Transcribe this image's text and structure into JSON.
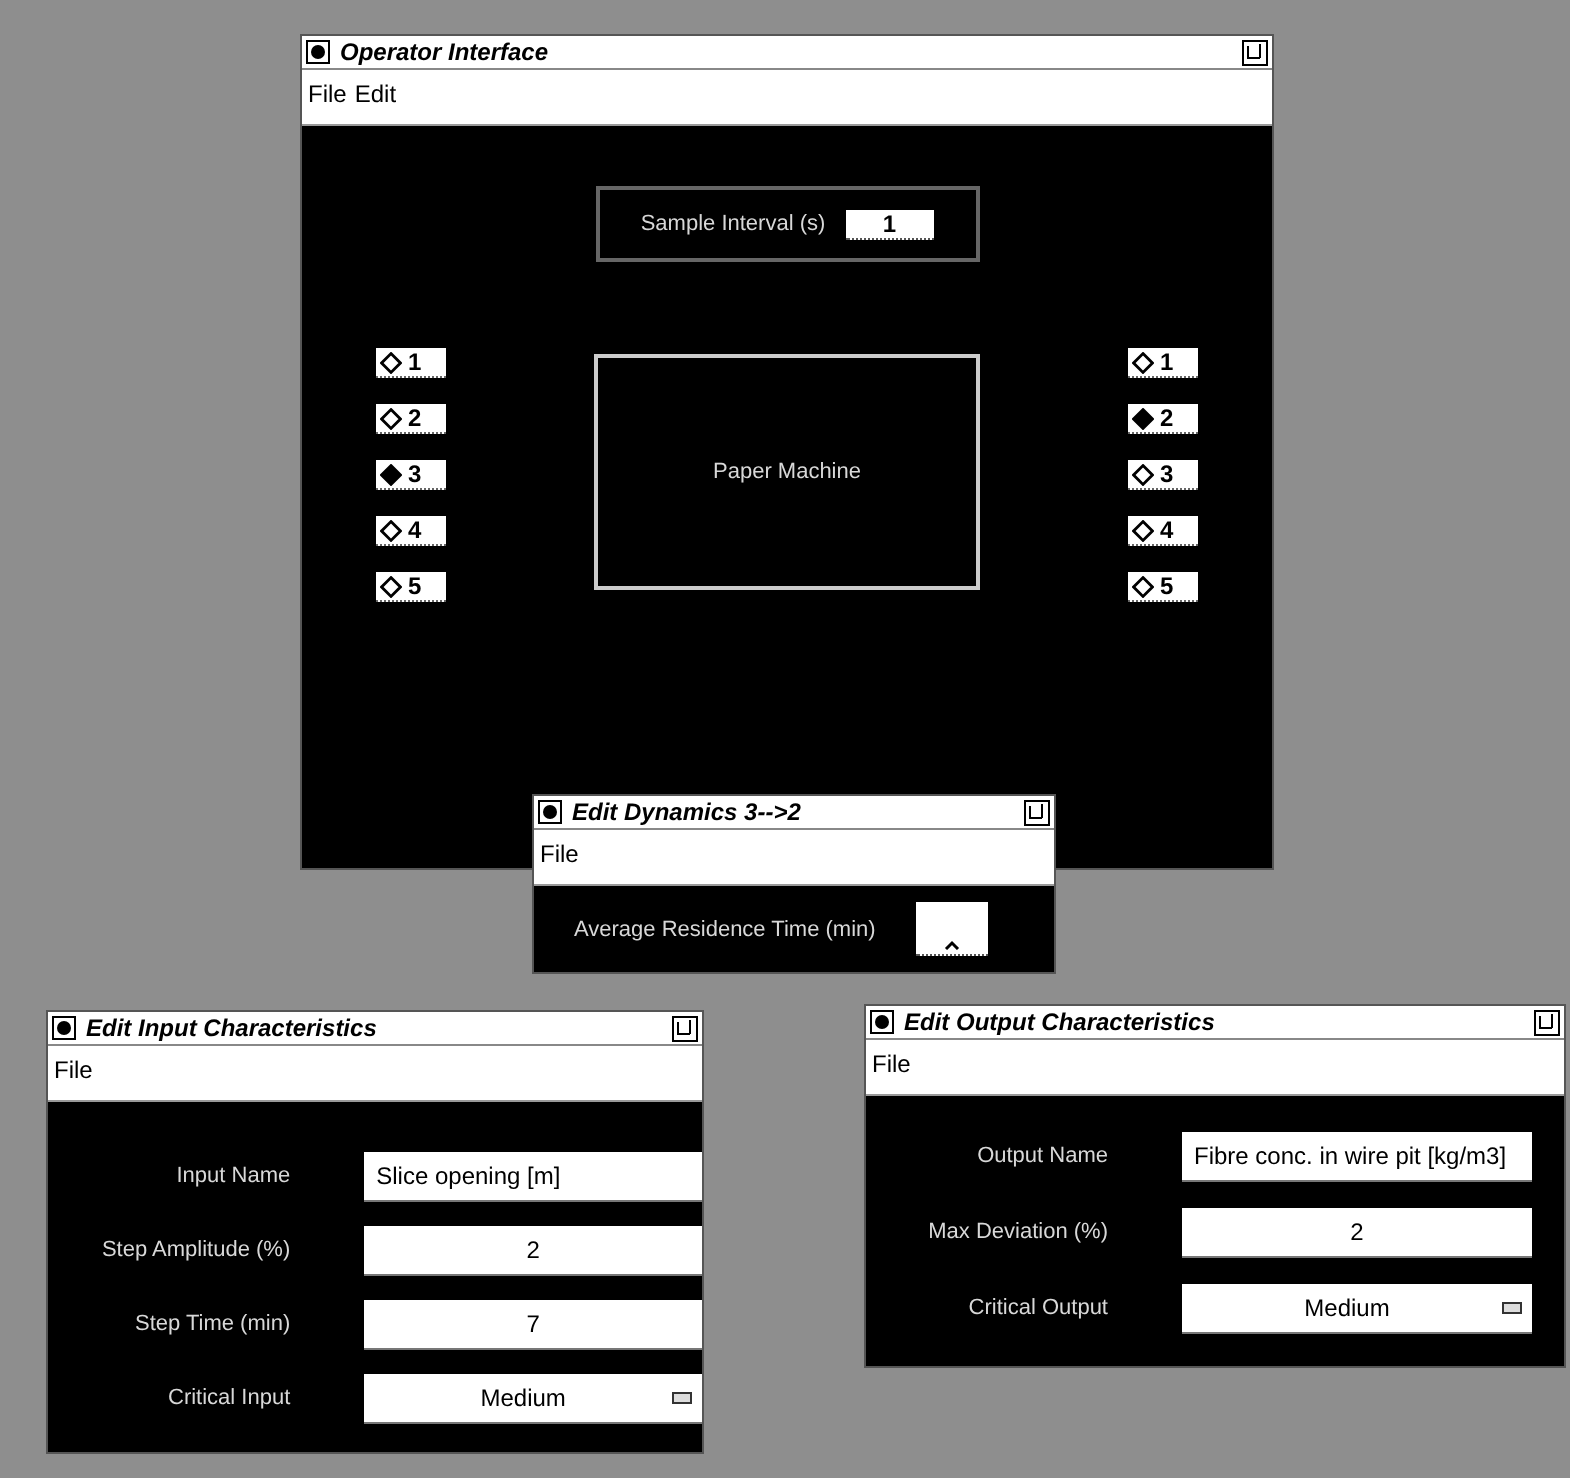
{
  "operator_window": {
    "title": "Operator Interface",
    "menu": [
      "File",
      "Edit"
    ],
    "sample_interval": {
      "label": "Sample Interval (s)",
      "value": "1"
    },
    "inputs": [
      {
        "label": "1",
        "selected": false
      },
      {
        "label": "2",
        "selected": false
      },
      {
        "label": "3",
        "selected": true
      },
      {
        "label": "4",
        "selected": false
      },
      {
        "label": "5",
        "selected": false
      }
    ],
    "process_box": "Paper Machine",
    "outputs": [
      {
        "label": "1",
        "selected": false
      },
      {
        "label": "2",
        "selected": true
      },
      {
        "label": "3",
        "selected": false
      },
      {
        "label": "4",
        "selected": false
      },
      {
        "label": "5",
        "selected": false
      }
    ]
  },
  "dynamics_window": {
    "title": "Edit Dynamics 3-->2",
    "menu": [
      "File"
    ],
    "field": {
      "label": "Average Residence Time (min)"
    }
  },
  "input_window": {
    "title": "Edit Input Characteristics",
    "menu": [
      "File"
    ],
    "fields": [
      {
        "kind": "text",
        "label": "Input Name",
        "value": "Slice opening [m]"
      },
      {
        "kind": "number",
        "label": "Step Amplitude (%)",
        "value": "2"
      },
      {
        "kind": "number",
        "label": "Step Time (min)",
        "value": "7"
      },
      {
        "kind": "select",
        "label": "Critical Input",
        "value": "Medium"
      }
    ]
  },
  "output_window": {
    "title": "Edit Output Characteristics",
    "menu": [
      "File"
    ],
    "fields": [
      {
        "kind": "text",
        "label": "Output Name",
        "value": "Fibre conc. in wire pit [kg/m3]"
      },
      {
        "kind": "number",
        "label": "Max Deviation (%)",
        "value": "2"
      },
      {
        "kind": "select",
        "label": "Critical Output",
        "value": "Medium"
      }
    ]
  }
}
